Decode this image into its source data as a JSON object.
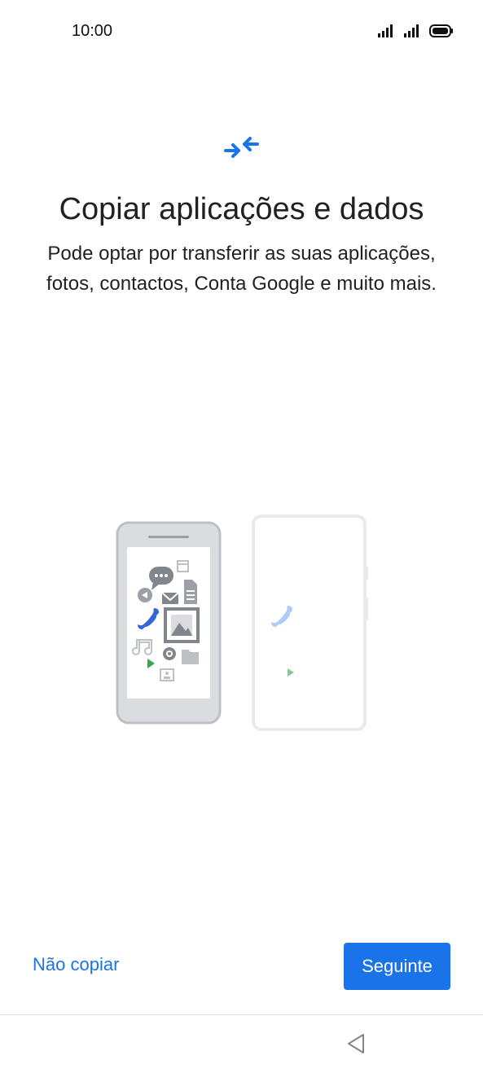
{
  "status_bar": {
    "time": "10:00",
    "icons": [
      "signal-icon",
      "signal-icon",
      "battery-icon"
    ]
  },
  "header": {
    "icon": "transfer-arrows-icon",
    "title": "Copiar aplicações e dados",
    "subtitle": "Pode optar por transferir as suas aplicações, fotos, contactos, Conta Google e muito mais."
  },
  "illustration": {
    "old_phone_icons": [
      "chat-icon",
      "calendar-icon",
      "document-icon",
      "email-icon",
      "play-circle-icon",
      "phone-icon",
      "photo-icon",
      "music-icon",
      "settings-icon",
      "folder-icon",
      "play-store-icon",
      "contact-icon"
    ],
    "new_phone_icons": [
      "phone-icon",
      "play-store-icon"
    ],
    "colors": {
      "accent": "#1a73e8",
      "phone_gray": "#cfd2d6",
      "screen_gray": "#f1f3f4",
      "icon_gray": "#80868b",
      "play_green": "#34a853",
      "faded_blue": "#aecbfa"
    }
  },
  "actions": {
    "skip_label": "Não copiar",
    "next_label": "Seguinte"
  },
  "nav_bar": {
    "back_icon": "back-triangle-icon"
  }
}
